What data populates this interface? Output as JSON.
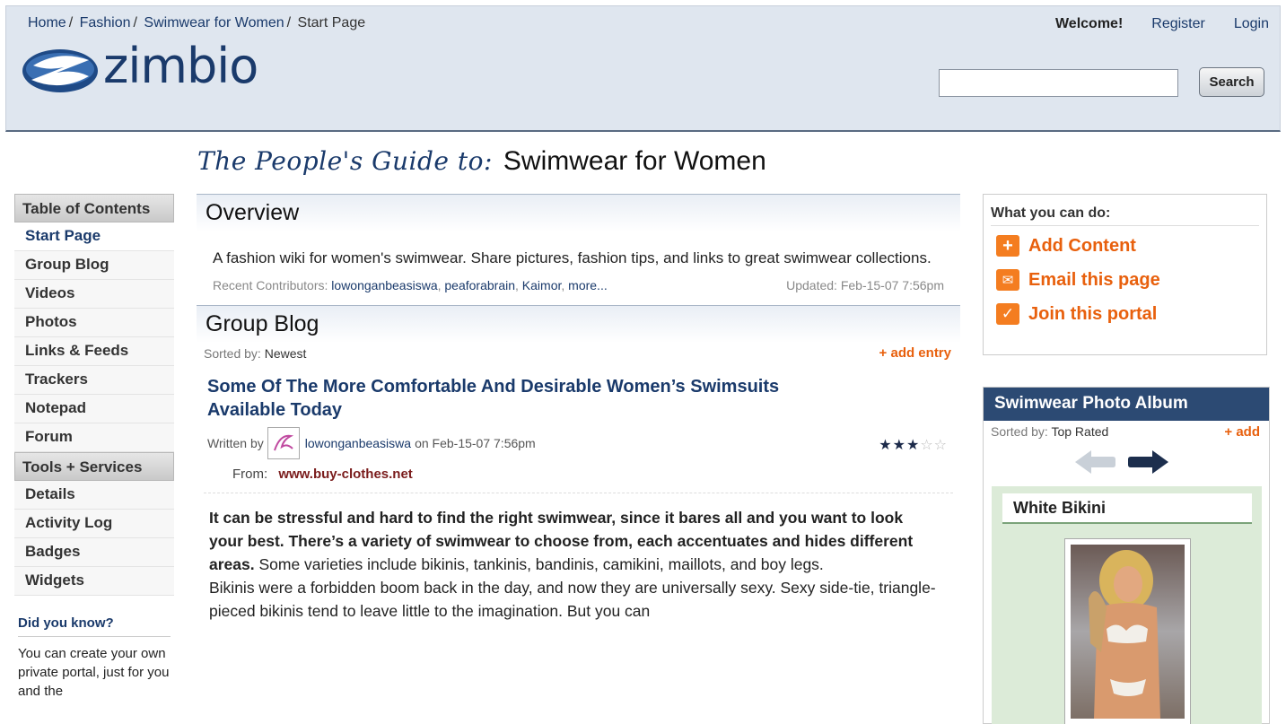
{
  "header": {
    "breadcrumb": [
      "Home",
      "Fashion",
      "Swimwear for Women",
      "Start Page"
    ],
    "logo_text": "zimbio",
    "welcome": "Welcome!",
    "register": "Register",
    "login": "Login",
    "search_placeholder": "",
    "search_button": "Search"
  },
  "page_title": {
    "lead": "The People's Guide to:",
    "topic": "Swimwear for Women"
  },
  "sidebar": {
    "toc_header": "Table of Contents",
    "toc_items": [
      "Start Page",
      "Group Blog",
      "Videos",
      "Photos",
      "Links & Feeds",
      "Trackers",
      "Notepad",
      "Forum"
    ],
    "tools_header": "Tools + Services",
    "tools_items": [
      "Details",
      "Activity Log",
      "Badges",
      "Widgets"
    ],
    "did_you_know_title": "Did you know?",
    "did_you_know_text": "You can create your own private portal, just for you and the"
  },
  "overview": {
    "heading": "Overview",
    "text": "A fashion wiki for women's swimwear. Share pictures, fashion tips, and links to great swimwear collections.",
    "contributors_label": "Recent Contributors:",
    "contributors": [
      "lowonganbeasiswa",
      "peaforabrain",
      "Kaimor",
      "more..."
    ],
    "updated": "Updated: Feb-15-07 7:56pm"
  },
  "group_blog": {
    "heading": "Group Blog",
    "sorted_label": "Sorted by:",
    "sorted_value": "Newest",
    "add_entry": "+ add entry",
    "entry": {
      "title": "Some Of The More Comfortable And Desirable Women’s Swimsuits Available Today",
      "rating": 3,
      "rating_max": 5,
      "written_by": "Written by",
      "author": "lowonganbeasiswa",
      "date": "on Feb-15-07 7:56pm",
      "from_label": "From:",
      "from_link": "www.buy-clothes.net",
      "body_bold": "It can be stressful and hard to find the right swimwear, since it bares all and you want to look your best. There’s a variety of swimwear to choose from, each accentuates and hides different areas.",
      "body_rest": " Some varieties include bikinis, tankinis, bandinis, camikini, maillots, and boy legs.",
      "body_p2": "Bikinis were a forbidden boom back in the day, and now they are universally sexy. Sexy side-tie, triangle-pieced bikinis tend to leave little to the imagination. But you can"
    }
  },
  "actions": {
    "heading": "What you can do:",
    "items": [
      {
        "label": "Add Content",
        "icon": "plus-icon"
      },
      {
        "label": "Email this page",
        "icon": "envelope-icon"
      },
      {
        "label": "Join this portal",
        "icon": "checkmark-icon"
      }
    ],
    "accent": "#e8600d"
  },
  "album": {
    "heading": "Swimwear Photo Album",
    "sorted_label": "Sorted by:",
    "sorted_value": "Top Rated",
    "add": "+ add",
    "photo_title": "White Bikini"
  }
}
